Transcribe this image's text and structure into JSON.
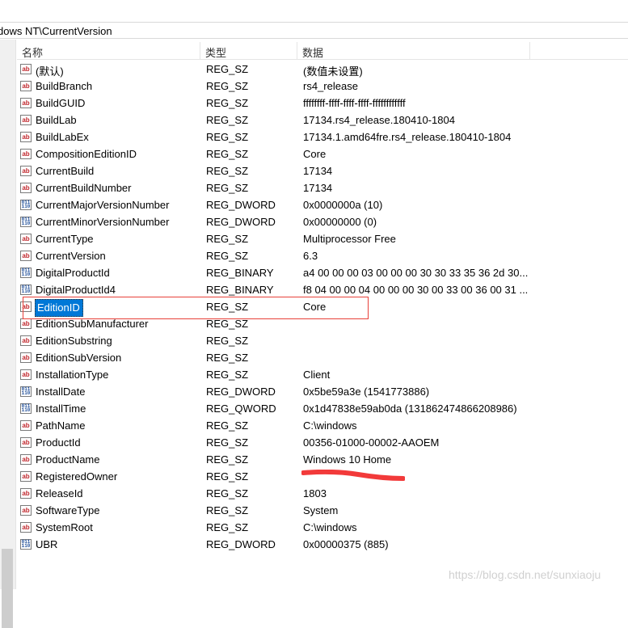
{
  "address": {
    "path": "dows NT\\CurrentVersion"
  },
  "columns": {
    "name": "名称",
    "type": "类型",
    "data": "数据"
  },
  "rows": [
    {
      "icon": "string-icon",
      "name": "(默认)",
      "type": "REG_SZ",
      "data": "(数值未设置)"
    },
    {
      "icon": "string-icon",
      "name": "BuildBranch",
      "type": "REG_SZ",
      "data": "rs4_release"
    },
    {
      "icon": "string-icon",
      "name": "BuildGUID",
      "type": "REG_SZ",
      "data": "ffffffff-ffff-ffff-ffff-ffffffffffff"
    },
    {
      "icon": "string-icon",
      "name": "BuildLab",
      "type": "REG_SZ",
      "data": "17134.rs4_release.180410-1804"
    },
    {
      "icon": "string-icon",
      "name": "BuildLabEx",
      "type": "REG_SZ",
      "data": "17134.1.amd64fre.rs4_release.180410-1804"
    },
    {
      "icon": "string-icon",
      "name": "CompositionEditionID",
      "type": "REG_SZ",
      "data": "Core"
    },
    {
      "icon": "string-icon",
      "name": "CurrentBuild",
      "type": "REG_SZ",
      "data": "17134"
    },
    {
      "icon": "string-icon",
      "name": "CurrentBuildNumber",
      "type": "REG_SZ",
      "data": "17134"
    },
    {
      "icon": "binary-icon",
      "name": "CurrentMajorVersionNumber",
      "type": "REG_DWORD",
      "data": "0x0000000a (10)"
    },
    {
      "icon": "binary-icon",
      "name": "CurrentMinorVersionNumber",
      "type": "REG_DWORD",
      "data": "0x00000000 (0)"
    },
    {
      "icon": "string-icon",
      "name": "CurrentType",
      "type": "REG_SZ",
      "data": "Multiprocessor Free"
    },
    {
      "icon": "string-icon",
      "name": "CurrentVersion",
      "type": "REG_SZ",
      "data": "6.3"
    },
    {
      "icon": "binary-icon",
      "name": "DigitalProductId",
      "type": "REG_BINARY",
      "data": "a4 00 00 00 03 00 00 00 30 30 33 35 36 2d 30..."
    },
    {
      "icon": "binary-icon",
      "name": "DigitalProductId4",
      "type": "REG_BINARY",
      "data": "f8 04 00 00 04 00 00 00 30 00 33 00 36 00 31 ..."
    },
    {
      "icon": "string-icon",
      "name": "EditionID",
      "type": "REG_SZ",
      "data": "Core",
      "selected": true
    },
    {
      "icon": "string-icon",
      "name": "EditionSubManufacturer",
      "type": "REG_SZ",
      "data": ""
    },
    {
      "icon": "string-icon",
      "name": "EditionSubstring",
      "type": "REG_SZ",
      "data": ""
    },
    {
      "icon": "string-icon",
      "name": "EditionSubVersion",
      "type": "REG_SZ",
      "data": ""
    },
    {
      "icon": "string-icon",
      "name": "InstallationType",
      "type": "REG_SZ",
      "data": "Client"
    },
    {
      "icon": "binary-icon",
      "name": "InstallDate",
      "type": "REG_DWORD",
      "data": "0x5be59a3e (1541773886)"
    },
    {
      "icon": "binary-icon",
      "name": "InstallTime",
      "type": "REG_QWORD",
      "data": "0x1d47838e59ab0da (131862474866208986)"
    },
    {
      "icon": "string-icon",
      "name": "PathName",
      "type": "REG_SZ",
      "data": "C:\\windows"
    },
    {
      "icon": "string-icon",
      "name": "ProductId",
      "type": "REG_SZ",
      "data": "00356-01000-00002-AAOEM"
    },
    {
      "icon": "string-icon",
      "name": "ProductName",
      "type": "REG_SZ",
      "data": "Windows 10 Home"
    },
    {
      "icon": "string-icon",
      "name": "RegisteredOwner",
      "type": "REG_SZ",
      "data": ""
    },
    {
      "icon": "string-icon",
      "name": "ReleaseId",
      "type": "REG_SZ",
      "data": "1803"
    },
    {
      "icon": "string-icon",
      "name": "SoftwareType",
      "type": "REG_SZ",
      "data": "System"
    },
    {
      "icon": "string-icon",
      "name": "SystemRoot",
      "type": "REG_SZ",
      "data": "C:\\windows"
    },
    {
      "icon": "binary-icon",
      "name": "UBR",
      "type": "REG_DWORD",
      "data": "0x00000375 (885)"
    }
  ],
  "icon_text": {
    "string": "ab",
    "binary": "011\n110"
  },
  "colors": {
    "selection": "#0078d7",
    "highlight_border": "#e8413a",
    "redaction": "#f23a3a"
  },
  "watermark": "https://blog.csdn.net/sunxiaoju"
}
